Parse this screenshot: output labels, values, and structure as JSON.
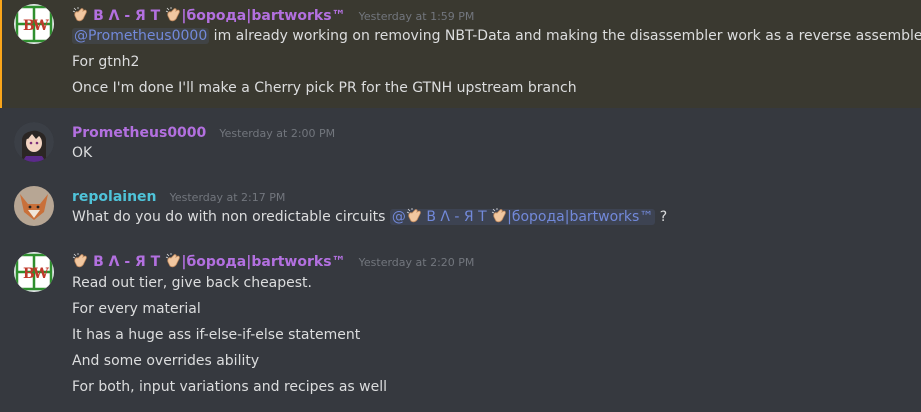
{
  "colors": {
    "background": "#36393f",
    "text": "#dcddde",
    "timestamp": "#72767d",
    "mention": "#7289da",
    "highlight_bar": "#faa61a",
    "bw_user": "#b370e0",
    "prometheus_user": "#b370e0",
    "repolainen_user": "#4fc3d9"
  },
  "messages": [
    {
      "author_prefix": "В Λ - Я Т",
      "author_suffix": "|борода|bartworks™",
      "timestamp": "Yesterday at 1:59 PM",
      "avatar_icon": "bartworks-logo-icon",
      "mention": "@Prometheus0000",
      "lines": [
        " im already working on removing NBT-Data and making the disassembler work as a reverse assembler",
        "For gtnh2",
        "Once I'm done I'll make a Cherry pick PR for the GTNH upstream branch"
      ]
    },
    {
      "author": "Prometheus0000",
      "timestamp": "Yesterday at 2:00 PM",
      "avatar_icon": "anime-avatar-icon",
      "lines": [
        "OK"
      ]
    },
    {
      "author": "repolainen",
      "timestamp": "Yesterday at 2:17 PM",
      "avatar_icon": "fox-avatar-icon",
      "line_start": "What do you do with non oredictable circuits ",
      "mention_prefix": "@",
      "mention_name": "В Λ - Я Т",
      "mention_suffix": "|борода|bartworks™",
      "line_end": " ?"
    },
    {
      "author_prefix": "В Λ - Я Т",
      "author_suffix": "|борода|bartworks™",
      "timestamp": "Yesterday at 2:20 PM",
      "avatar_icon": "bartworks-logo-icon",
      "lines": [
        "Read out tier, give back cheapest.",
        "For every material",
        "It has a huge ass if-else-if-else statement",
        "And some overrides ability",
        "For both, input variations and recipes as well"
      ]
    }
  ]
}
